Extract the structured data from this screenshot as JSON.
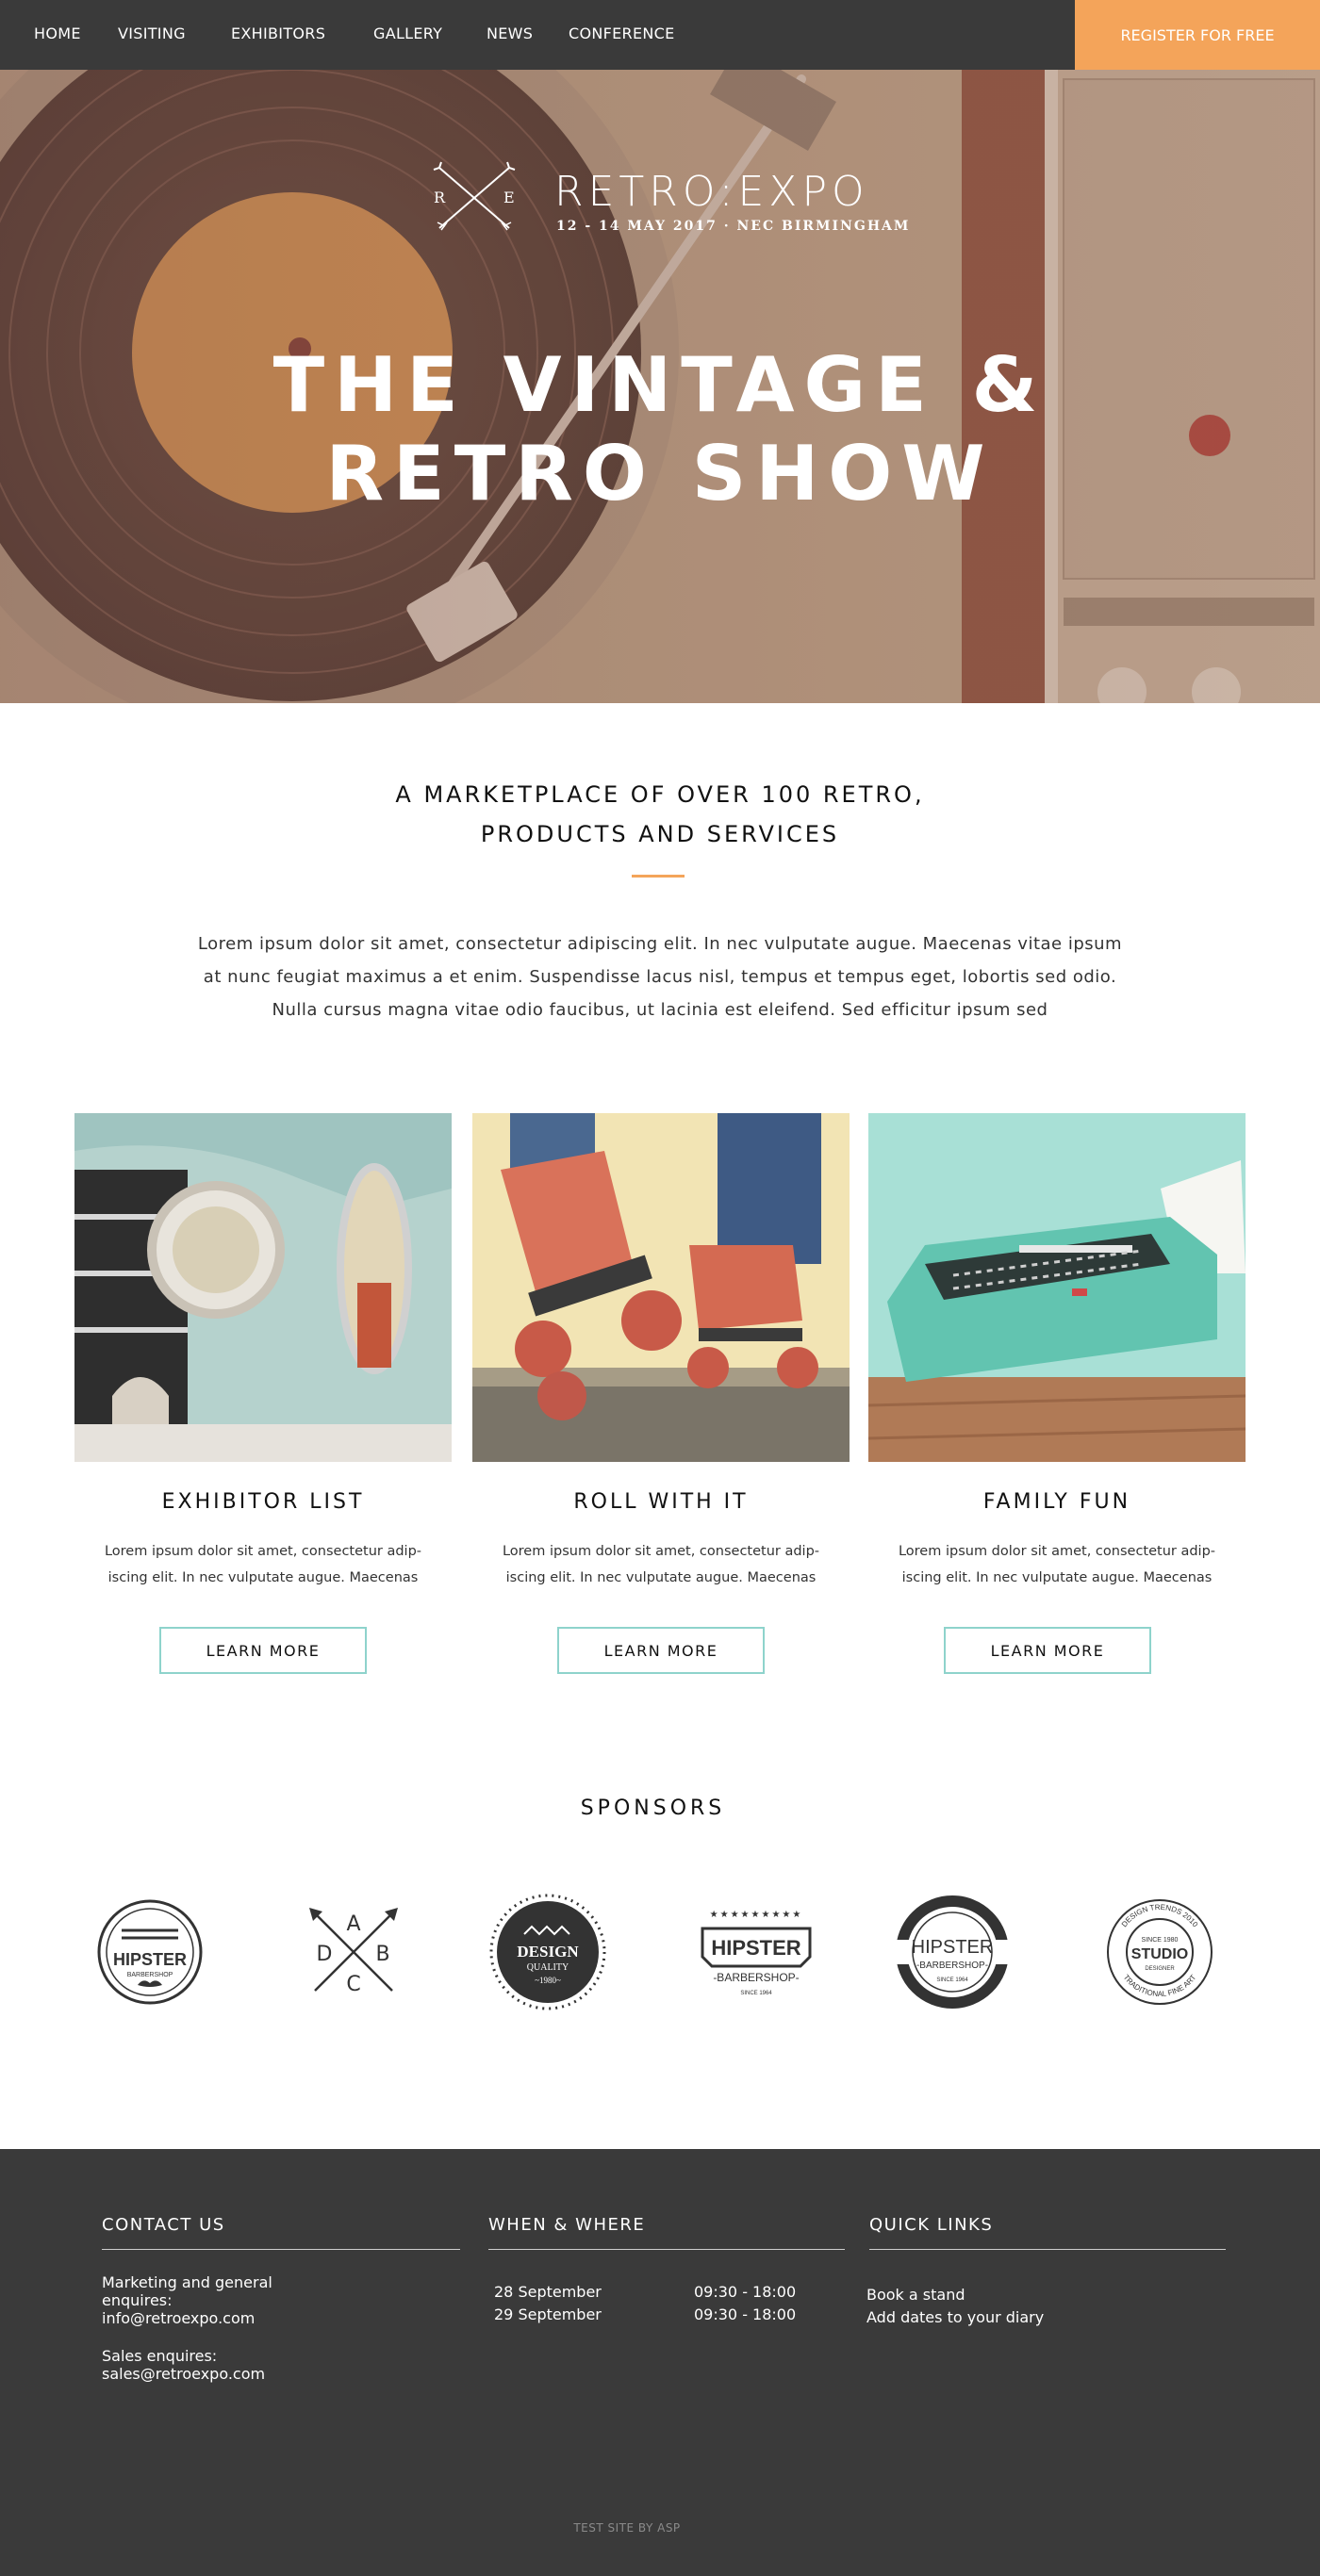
{
  "nav": {
    "items": [
      "HOME",
      "VISITING",
      "EXHIBITORS",
      "GALLERY",
      "NEWS",
      "CONFERENCE"
    ],
    "register_label": "REGISTER FOR FREE"
  },
  "hero": {
    "logo_letters": [
      "R",
      "E"
    ],
    "logo_name": "RETRO:EXPO",
    "logo_date": "12 - 14 MAY 2017 · NEC BIRMINGHAM",
    "title_line1": "THE VINTAGE &",
    "title_line2": "RETRO SHOW"
  },
  "intro": {
    "heading_line1": "A MARKETPLACE OF OVER 100 RETRO,",
    "heading_line2": "PRODUCTS AND SERVICES",
    "body": "Lorem ipsum dolor sit amet, consectetur adipiscing elit. In nec vulputate augue. Maecenas vitae ipsum at nunc feugiat maximus a et enim. Suspendisse lacus nisl, tempus et tempus eget, lobortis sed odio. Nulla cursus magna vitae odio faucibus, ut lacinia est eleifend. Sed efficitur ipsum sed"
  },
  "cards": [
    {
      "title": "EXHIBITOR LIST",
      "text": "Lorem ipsum dolor sit amet, consectetur adip-iscing elit. In nec vulputate augue. Maecenas",
      "button": "LEARN MORE"
    },
    {
      "title": "ROLL WITH IT",
      "text": "Lorem ipsum dolor sit amet, consectetur adip-iscing elit. In nec vulputate augue. Maecenas",
      "button": "LEARN MORE"
    },
    {
      "title": "FAMILY FUN",
      "text": "Lorem ipsum dolor sit amet, consectetur adip-iscing elit. In nec vulputate augue. Maecenas",
      "button": "LEARN MORE"
    }
  ],
  "sponsors": {
    "title": "SPONSORS",
    "logos": [
      {
        "top": "HIPSTER",
        "bottom": "BARBERSHOP"
      },
      {
        "letters": [
          "A",
          "D",
          "B",
          "C"
        ]
      },
      {
        "top": "DESIGN",
        "middle": "QUALITY",
        "bottom": "~1980~"
      },
      {
        "top": "HIPSTER",
        "middle": "-BARBERSHOP-",
        "bottom": "SINCE 1964"
      },
      {
        "top": "HIPSTER",
        "middle": "-BARBERSHOP-",
        "bottom": "SINCE 1964"
      },
      {
        "ring_top": "DESIGN TRENDS 2010",
        "top": "SINCE 1980",
        "middle": "STUDIO",
        "bottom": "DESIGNER",
        "ring_bottom": "TRADITIONAL FINE ART"
      }
    ]
  },
  "footer": {
    "contact": {
      "title": "CONTACT US",
      "general_line1": "Marketing and general",
      "general_line2": "enquires:",
      "general_email": "info@retroexpo.com",
      "sales_label": "Sales enquires:",
      "sales_email": "sales@retroexpo.com"
    },
    "when": {
      "title": "WHEN & WHERE",
      "rows": [
        {
          "date": "28 September",
          "time": "09:30 - 18:00"
        },
        {
          "date": "29 September",
          "time": "09:30 - 18:00"
        }
      ]
    },
    "links": {
      "title": "QUICK LINKS",
      "items": [
        "Book a stand",
        "Add dates to your diary"
      ]
    },
    "credit": "TEST SITE BY ASP"
  },
  "colors": {
    "accent": "#f4a45a",
    "dark": "#3a3a3a",
    "button_border": "#8ed3cc"
  }
}
